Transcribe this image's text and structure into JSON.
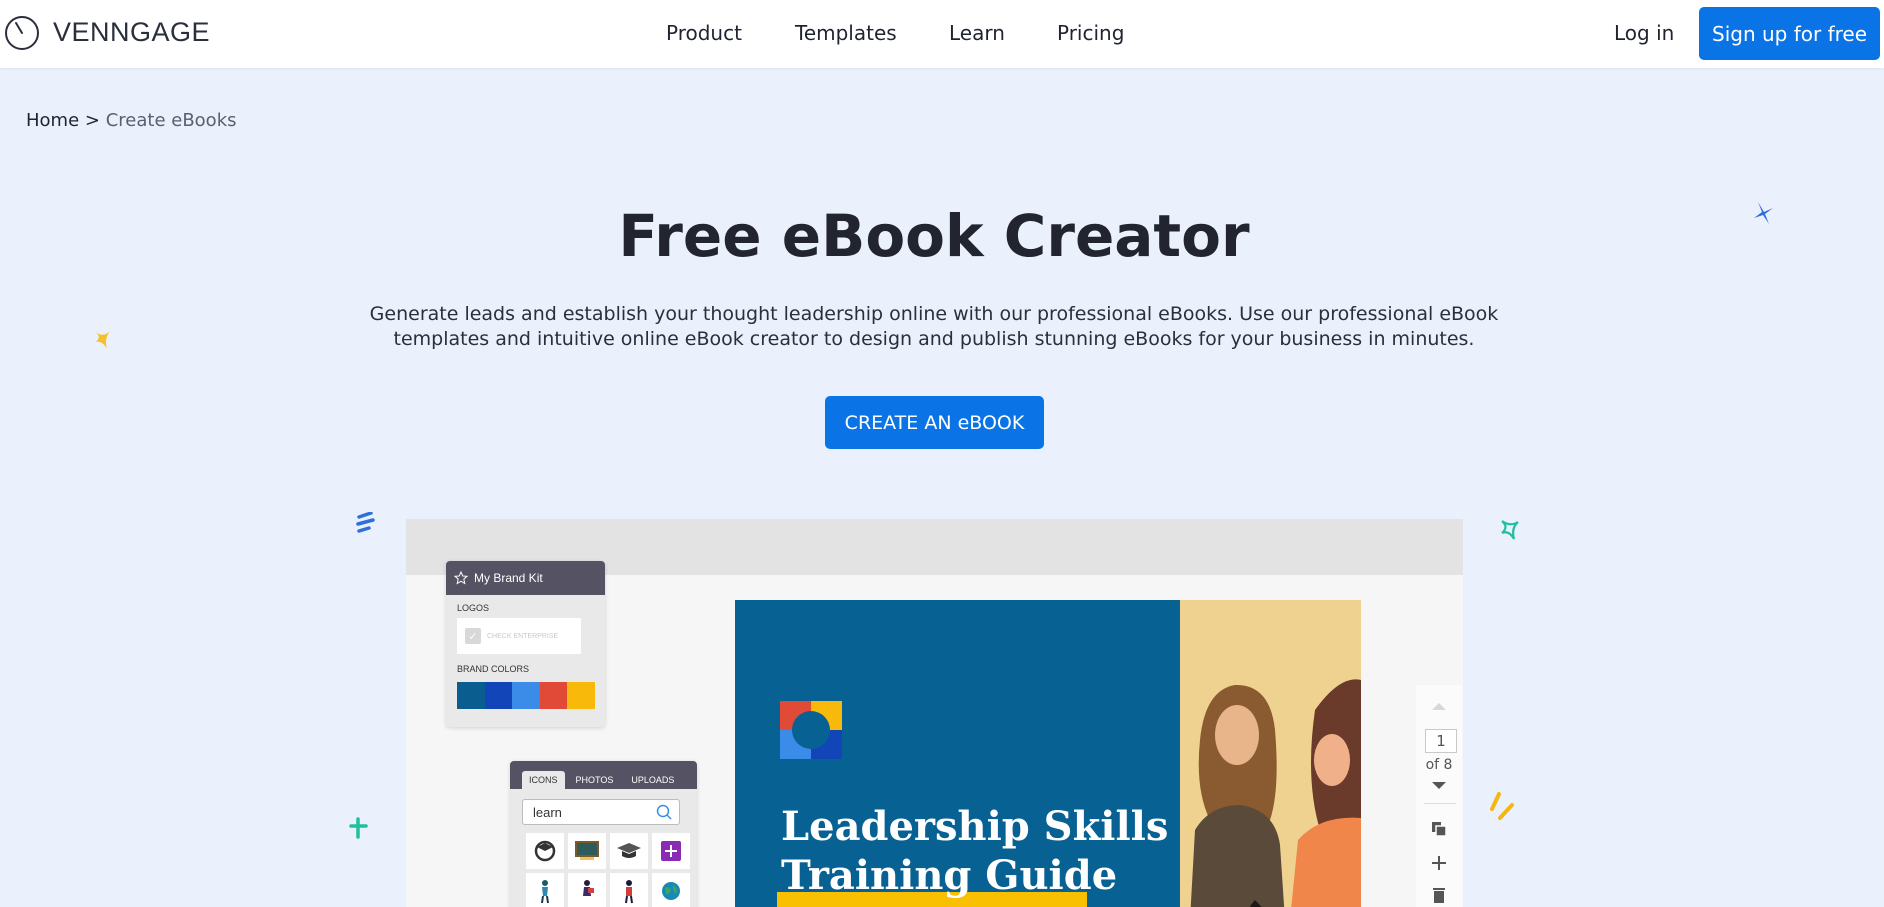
{
  "header": {
    "brand": "VENNGAGE",
    "nav": [
      {
        "label": "Product"
      },
      {
        "label": "Templates"
      },
      {
        "label": "Learn"
      },
      {
        "label": "Pricing"
      }
    ],
    "login_label": "Log in",
    "signup_label": "Sign up for free"
  },
  "breadcrumb": {
    "home": "Home",
    "separator": ">",
    "current": "Create eBooks"
  },
  "hero": {
    "title": "Free eBook Creator",
    "description": "Generate leads and establish your thought leadership online with our professional eBooks. Use our professional eBook templates and intuitive online eBook creator to design and publish stunning eBooks for your business in minutes.",
    "cta_label": "CREATE AN eBOOK"
  },
  "preview": {
    "brand_kit": {
      "title": "My Brand Kit",
      "logos_label": "LOGOS",
      "logo_text": "CHECK ENTERPRISE",
      "colors_label": "BRAND COLORS",
      "colors": [
        "#0a5e8f",
        "#1246b8",
        "#3b8ce8",
        "#e04a36",
        "#f8b90b"
      ]
    },
    "icon_panel": {
      "tabs": [
        "ICONS",
        "PHOTOS",
        "UPLOADS"
      ],
      "search_value": "learn"
    },
    "cover": {
      "title_line1": "Leadership Skills",
      "title_line2": "Training Guide"
    },
    "pager": {
      "current": "1",
      "total_label": "of 8"
    }
  },
  "colors": {
    "accent": "#0a74e6",
    "page_background": "#eaf1fc",
    "cover_blue": "#076192"
  }
}
